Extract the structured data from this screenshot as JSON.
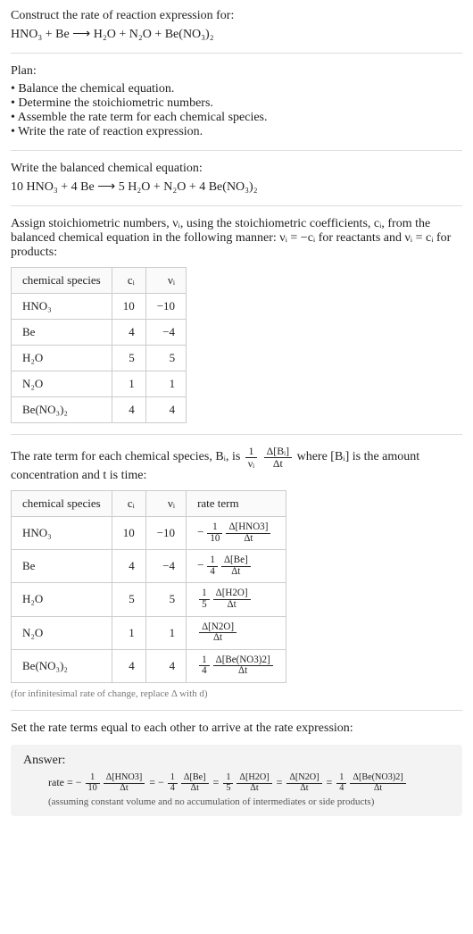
{
  "prompt": {
    "lead": "Construct the rate of reaction expression for:",
    "equation": "HNO₃ + Be  ⟶  H₂O + N₂O + Be(NO₃)₂"
  },
  "plan": {
    "heading": "Plan:",
    "b1": "• Balance the chemical equation.",
    "b2": "• Determine the stoichiometric numbers.",
    "b3": "• Assemble the rate term for each chemical species.",
    "b4": "• Write the rate of reaction expression."
  },
  "balanced": {
    "heading": "Write the balanced chemical equation:",
    "equation": "10 HNO₃ + 4 Be  ⟶  5 H₂O + N₂O + 4 Be(NO₃)₂"
  },
  "assign": {
    "text": "Assign stoichiometric numbers, νᵢ, using the stoichiometric coefficients, cᵢ, from the balanced chemical equation in the following manner: νᵢ = −cᵢ for reactants and νᵢ = cᵢ for products:",
    "headers": {
      "species": "chemical species",
      "ci": "cᵢ",
      "vi": "νᵢ"
    },
    "rows": [
      {
        "species": "HNO₃",
        "ci": "10",
        "vi": "−10"
      },
      {
        "species": "Be",
        "ci": "4",
        "vi": "−4"
      },
      {
        "species": "H₂O",
        "ci": "5",
        "vi": "5"
      },
      {
        "species": "N₂O",
        "ci": "1",
        "vi": "1"
      },
      {
        "species": "Be(NO₃)₂",
        "ci": "4",
        "vi": "4"
      }
    ]
  },
  "rateterm": {
    "pre": "The rate term for each chemical species, Bᵢ, is ",
    "post": " where [Bᵢ] is the amount concentration and t is time:",
    "formula": {
      "one_over_nu": {
        "num": "1",
        "den": "νᵢ"
      },
      "dB": {
        "num": "Δ[Bᵢ]",
        "den": "Δt"
      }
    },
    "headers": {
      "species": "chemical species",
      "ci": "cᵢ",
      "vi": "νᵢ",
      "rt": "rate term"
    },
    "rows": [
      {
        "species": "HNO₃",
        "ci": "10",
        "vi": "−10",
        "neg": "−",
        "fnum": "1",
        "fden": "10",
        "dnum": "Δ[HNO3]",
        "dden": "Δt"
      },
      {
        "species": "Be",
        "ci": "4",
        "vi": "−4",
        "neg": "−",
        "fnum": "1",
        "fden": "4",
        "dnum": "Δ[Be]",
        "dden": "Δt"
      },
      {
        "species": "H₂O",
        "ci": "5",
        "vi": "5",
        "neg": "",
        "fnum": "1",
        "fden": "5",
        "dnum": "Δ[H2O]",
        "dden": "Δt"
      },
      {
        "species": "N₂O",
        "ci": "1",
        "vi": "1",
        "neg": "",
        "fnum": "",
        "fden": "",
        "dnum": "Δ[N2O]",
        "dden": "Δt"
      },
      {
        "species": "Be(NO₃)₂",
        "ci": "4",
        "vi": "4",
        "neg": "",
        "fnum": "1",
        "fden": "4",
        "dnum": "Δ[Be(NO3)2]",
        "dden": "Δt"
      }
    ],
    "footnote": "(for infinitesimal rate of change, replace Δ with d)"
  },
  "final": {
    "heading": "Set the rate terms equal to each other to arrive at the rate expression:"
  },
  "answer": {
    "label": "Answer:",
    "prefix": "rate = ",
    "terms": [
      {
        "neg": "−",
        "fnum": "1",
        "fden": "10",
        "dnum": "Δ[HNO3]",
        "dden": "Δt"
      },
      {
        "neg": "−",
        "fnum": "1",
        "fden": "4",
        "dnum": "Δ[Be]",
        "dden": "Δt"
      },
      {
        "neg": "",
        "fnum": "1",
        "fden": "5",
        "dnum": "Δ[H2O]",
        "dden": "Δt"
      },
      {
        "neg": "",
        "fnum": "",
        "fden": "",
        "dnum": "Δ[N2O]",
        "dden": "Δt"
      },
      {
        "neg": "",
        "fnum": "1",
        "fden": "4",
        "dnum": "Δ[Be(NO3)2]",
        "dden": "Δt"
      }
    ],
    "eq": " = ",
    "note": "(assuming constant volume and no accumulation of intermediates or side products)"
  }
}
